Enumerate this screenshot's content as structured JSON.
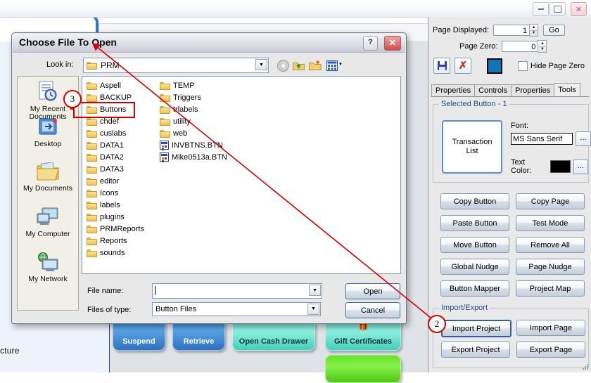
{
  "window": {
    "controls": [
      {
        "name": "minimize",
        "label": "_"
      },
      {
        "name": "maximize",
        "label": "□"
      },
      {
        "name": "close",
        "label": "✕"
      }
    ]
  },
  "background": {
    "left_text": "cture",
    "pos_buttons": [
      {
        "label": "Suspend",
        "color": "#3f8fd8"
      },
      {
        "label": "Retrieve",
        "color": "#3f8fd8"
      },
      {
        "label": "Open Cash Drawer",
        "color": "#7fe8d8"
      },
      {
        "label": "Gift Certificates",
        "color": "#7fe8d8"
      },
      {
        "label": "",
        "color": "#6ae62a"
      }
    ]
  },
  "right_panel": {
    "page_displayed": {
      "label": "Page Displayed:",
      "value": "1"
    },
    "page_zero": {
      "label": "Page Zero:",
      "value": "0"
    },
    "go_label": "Go",
    "save_icon": "save-icon",
    "discard_icon": "discard-icon",
    "page_color": "#1273b5",
    "hide_page_zero": {
      "label": "Hide Page Zero",
      "checked": false
    },
    "tabs": [
      {
        "label": "Properties",
        "active": false
      },
      {
        "label": "Controls",
        "active": false
      },
      {
        "label": "Properties",
        "active": false
      },
      {
        "label": "Tools",
        "active": true
      }
    ],
    "selected_button": {
      "title": "Selected Button - 1",
      "preview_label": "Transaction\nList",
      "font_label": "Font:",
      "font_value": "MS Sans Serif",
      "font_browse": "...",
      "text_color_label": "Text Color:",
      "text_color": "#000000",
      "text_color_browse": "..."
    },
    "tool_buttons": [
      "Copy Button",
      "Copy Page",
      "Paste Button",
      "Test Mode",
      "Move Button",
      "Remove All",
      "Global Nudge",
      "Page Nudge",
      "Button Mapper",
      "Project Map"
    ],
    "import_export": {
      "title": "Import/Export",
      "buttons": [
        "Import Project",
        "Import Page",
        "Export Project",
        "Export Page"
      ]
    }
  },
  "dialog": {
    "title": "Choose File To Open",
    "help_label": "?",
    "close_label": "✕",
    "lookin_label": "Look in:",
    "lookin_value": "PRM",
    "nav_icons": [
      "back-icon",
      "up-one-level-icon",
      "new-folder-icon",
      "views-icon"
    ],
    "files_col1": [
      {
        "name": "Aspell",
        "type": "folder"
      },
      {
        "name": "BACKUP",
        "type": "folder"
      },
      {
        "name": "Buttons",
        "type": "folder"
      },
      {
        "name": "chdef",
        "type": "folder"
      },
      {
        "name": "cuslabs",
        "type": "folder"
      },
      {
        "name": "DATA1",
        "type": "folder"
      },
      {
        "name": "DATA2",
        "type": "folder"
      },
      {
        "name": "DATA3",
        "type": "folder"
      },
      {
        "name": "editor",
        "type": "folder"
      },
      {
        "name": "Icons",
        "type": "folder"
      },
      {
        "name": "labels",
        "type": "folder"
      },
      {
        "name": "plugins",
        "type": "folder"
      },
      {
        "name": "PRMReports",
        "type": "folder"
      },
      {
        "name": "Reports",
        "type": "folder"
      },
      {
        "name": "sounds",
        "type": "folder"
      }
    ],
    "files_col2": [
      {
        "name": "TEMP",
        "type": "folder"
      },
      {
        "name": "Triggers",
        "type": "folder"
      },
      {
        "name": "trlabels",
        "type": "folder"
      },
      {
        "name": "utility",
        "type": "folder"
      },
      {
        "name": "web",
        "type": "folder"
      },
      {
        "name": "INVBTNS.BTN",
        "type": "btn-file"
      },
      {
        "name": "Mike0513a.BTN",
        "type": "btn-file"
      }
    ],
    "places": [
      {
        "label": "My Recent\nDocuments",
        "icon": "recent-documents-icon"
      },
      {
        "label": "Desktop",
        "icon": "desktop-icon"
      },
      {
        "label": "My Documents",
        "icon": "my-documents-icon"
      },
      {
        "label": "My Computer",
        "icon": "my-computer-icon"
      },
      {
        "label": "My Network",
        "icon": "my-network-icon"
      }
    ],
    "filename_label": "File name:",
    "filename_value": "",
    "filetype_label": "Files of type:",
    "filetype_value": "Button Files",
    "open_label": "Open",
    "cancel_label": "Cancel"
  },
  "annotations": {
    "marker_2": "2",
    "marker_3": "3",
    "accent_color": "#d40000"
  }
}
